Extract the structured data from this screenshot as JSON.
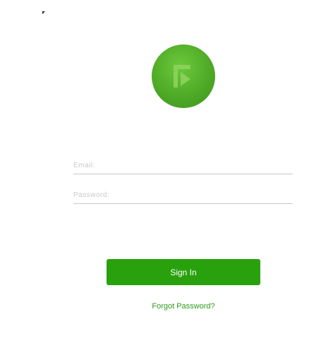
{
  "brand": {
    "logo_icon": "play-flag-icon",
    "logo_color": "#4faa27"
  },
  "form": {
    "email_placeholder": "Email:",
    "email_value": "",
    "password_placeholder": "Password:",
    "password_value": "",
    "signin_label": "Sign In",
    "forgot_label": "Forgot Password?"
  },
  "colors": {
    "primary_button": "#29a10d",
    "link": "#2e9a1a",
    "field_underline": "#c8c8c8"
  }
}
